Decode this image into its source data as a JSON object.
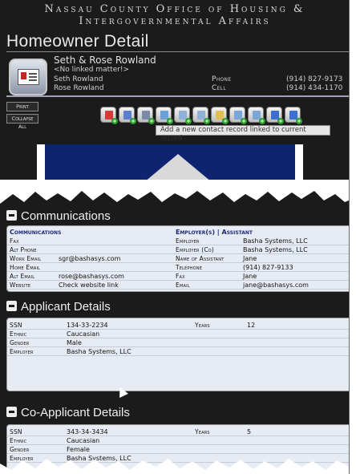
{
  "agency_title": "Nassau County Office of Housing & Intergovernmental Affairs",
  "page_title": "Homeowner Detail",
  "household": {
    "name": "Seth & Rose Rowland",
    "linked_matter": "<No linked matter!>",
    "member1": "Seth Rowland",
    "member2": "Rose Rowland",
    "phone_label": "Phone",
    "phone": "(914) 827-9173",
    "cell_label": "Cell",
    "cell": "(914) 434-1170"
  },
  "buttons": {
    "print": "Print",
    "collapse_all": "Collapse All"
  },
  "toolbar": {
    "icons": [
      "report-icon",
      "notes-icon",
      "contact-icon",
      "contact-icon",
      "document-icon",
      "document-icon",
      "folder-icon",
      "mail-icon",
      "mail-icon",
      "browser-icon",
      "browser-icon"
    ],
    "icon_colors": [
      "#d83a3a",
      "#5a7fcf",
      "#7c8aa8",
      "#6ea0d8",
      "#8fb0d8",
      "#8fb0d8",
      "#e0c050",
      "#7aa6d8",
      "#7aa6d8",
      "#3b6fd1",
      "#3b6fd1"
    ],
    "tooltip": "Add a new contact record linked to current record"
  },
  "communications": {
    "title": "Communications",
    "left_header": "Communications",
    "right_header": "Employer(s) | Assistant",
    "left": [
      {
        "label": "Fax",
        "value": ""
      },
      {
        "label": "Alt Phone",
        "value": ""
      },
      {
        "label": "Work Email",
        "value": "sgr@bashasys.com"
      },
      {
        "label": "Home Email",
        "value": ""
      },
      {
        "label": "Alt Email",
        "value": "rose@bashasys.com"
      },
      {
        "label": "Website",
        "value": "Check website link"
      }
    ],
    "right": [
      {
        "label": "Employer",
        "value": "Basha Systems, LLC"
      },
      {
        "label": "Employer (Co)",
        "value": "Basha Systems, LLC"
      },
      {
        "label": "Name of Assistant",
        "value": "Jane"
      },
      {
        "label": "Telephone",
        "value": "(914) 827-9133"
      },
      {
        "label": "Fax",
        "value": "Jane"
      },
      {
        "label": "Email",
        "value": "jane@bashasys.com"
      }
    ]
  },
  "applicant": {
    "title": "Applicant Details",
    "rows": [
      {
        "label": "SSN",
        "value": "134-33-2234",
        "label2": "Years",
        "value2": "12"
      },
      {
        "label": "Ethnic",
        "value": "Caucasian",
        "label2": "",
        "value2": ""
      },
      {
        "label": "Gender",
        "value": "Male",
        "label2": "",
        "value2": ""
      },
      {
        "label": "Employer",
        "value": "Basha Systems, LLC",
        "label2": "",
        "value2": ""
      }
    ]
  },
  "coapplicant": {
    "title": "Co-Applicant Details",
    "rows": [
      {
        "label": "SSN",
        "value": "343-34-3434",
        "label2": "Years",
        "value2": "5"
      },
      {
        "label": "Ethnic",
        "value": "Caucasian",
        "label2": "",
        "value2": ""
      },
      {
        "label": "Gender",
        "value": "Female",
        "label2": "",
        "value2": ""
      },
      {
        "label": "Employer",
        "value": "Basha Systems, LLC",
        "label2": "",
        "value2": ""
      }
    ]
  }
}
